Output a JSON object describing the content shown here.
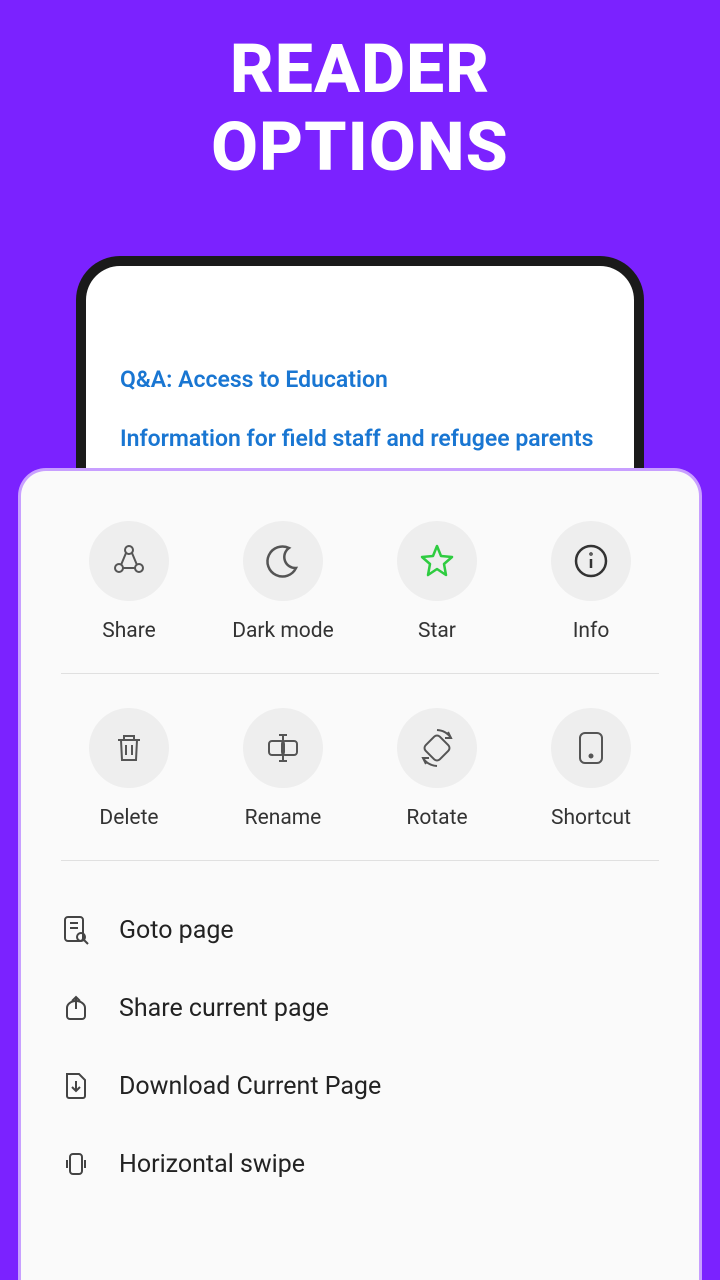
{
  "title_line1": "READER",
  "title_line2": "OPTIONS",
  "doc": {
    "title": "Q&A: Access to Education",
    "subtitle": "Information for field staff and refugee parents"
  },
  "actions_row1": [
    {
      "label": "Share"
    },
    {
      "label": "Dark mode"
    },
    {
      "label": "Star"
    },
    {
      "label": "Info"
    }
  ],
  "actions_row2": [
    {
      "label": "Delete"
    },
    {
      "label": "Rename"
    },
    {
      "label": "Rotate"
    },
    {
      "label": "Shortcut"
    }
  ],
  "list": [
    {
      "label": "Goto page"
    },
    {
      "label": "Share current page"
    },
    {
      "label": "Download Current Page"
    },
    {
      "label": "Horizontal swipe"
    }
  ]
}
